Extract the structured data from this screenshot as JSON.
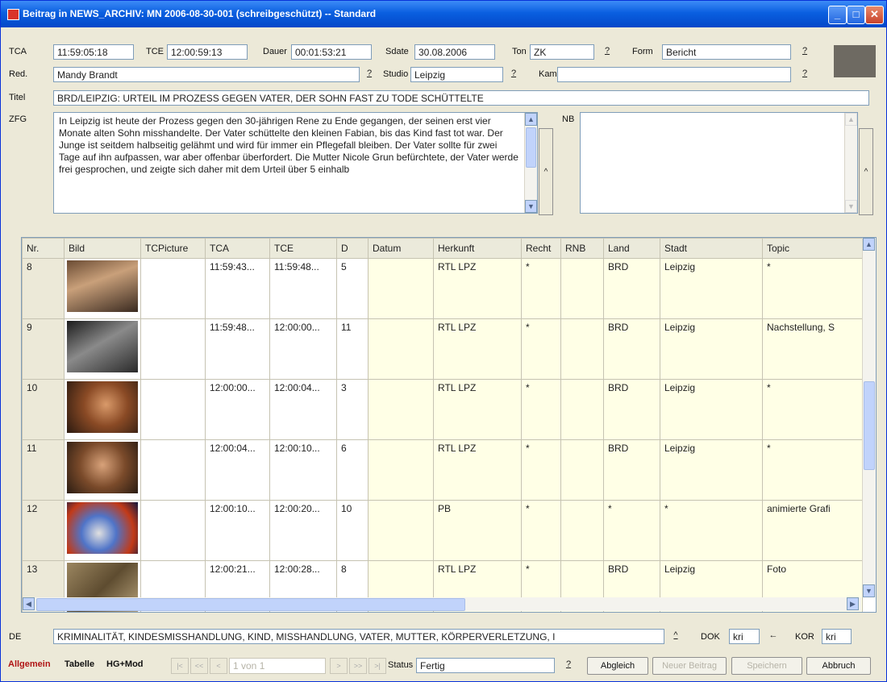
{
  "window": {
    "title": "Beitrag in NEWS_ARCHIV: MN 2006-08-30-001 (schreibgeschützt) -- Standard"
  },
  "fields": {
    "tca_label": "TCA",
    "tca": "11:59:05:18",
    "tce_label": "TCE",
    "tce": "12:00:59:13",
    "dauer_label": "Dauer",
    "dauer": "00:01:53:21",
    "sdate_label": "Sdate",
    "sdate": "30.08.2006",
    "ton_label": "Ton",
    "ton": "ZK",
    "form_label": "Form",
    "form": "Bericht",
    "red_label": "Red.",
    "red": "Mandy Brandt",
    "studio_label": "Studio",
    "studio": "Leipzig",
    "kam_label": "Kam",
    "kam": "",
    "titel_label": "Titel",
    "titel": "BRD/LEIPZIG: URTEIL IM PROZESS GEGEN VATER, DER SOHN FAST ZU TODE SCHÜTTELTE",
    "zfg_label": "ZFG",
    "zfg": "In Leipzig ist heute der Prozess gegen den 30-jährigen Rene zu Ende gegangen, der seinen erst vier Monate alten Sohn misshandelte. Der Vater schüttelte den kleinen Fabian, bis das Kind fast tot war. Der Junge ist seitdem halbseitig gelähmt und wird für immer ein Pflegefall bleiben. Der Vater sollte für zwei Tage auf ihn aufpassen, war aber offenbar überfordert. Die Mutter Nicole Grun befürchtete, der Vater werde frei gesprochen, und zeigte sich daher mit dem Urteil über 5 einhalb",
    "nb_label": "NB",
    "nb": "",
    "help": "?",
    "side_arrow": "^"
  },
  "table": {
    "columns": [
      "Nr.",
      "Bild",
      "TCPicture",
      "TCA",
      "TCE",
      "D",
      "Datum",
      "Herkunft",
      "Recht",
      "RNB",
      "Land",
      "Stadt",
      "Topic"
    ],
    "rows": [
      {
        "nr": "8",
        "tcpicture": "",
        "tca": "11:59:43...",
        "tce": "11:59:48...",
        "d": "5",
        "datum": "",
        "herkunft": "RTL LPZ",
        "recht": "*",
        "rnb": "",
        "land": "BRD",
        "stadt": "Leipzig",
        "topic": "*"
      },
      {
        "nr": "9",
        "tcpicture": "",
        "tca": "11:59:48...",
        "tce": "12:00:00...",
        "d": "11",
        "datum": "",
        "herkunft": "RTL LPZ",
        "recht": "*",
        "rnb": "",
        "land": "BRD",
        "stadt": "Leipzig",
        "topic": "Nachstellung, S"
      },
      {
        "nr": "10",
        "tcpicture": "",
        "tca": "12:00:00...",
        "tce": "12:00:04...",
        "d": "3",
        "datum": "",
        "herkunft": "RTL LPZ",
        "recht": "*",
        "rnb": "",
        "land": "BRD",
        "stadt": "Leipzig",
        "topic": "*"
      },
      {
        "nr": "11",
        "tcpicture": "",
        "tca": "12:00:04...",
        "tce": "12:00:10...",
        "d": "6",
        "datum": "",
        "herkunft": "RTL LPZ",
        "recht": "*",
        "rnb": "",
        "land": "BRD",
        "stadt": "Leipzig",
        "topic": "*"
      },
      {
        "nr": "12",
        "tcpicture": "",
        "tca": "12:00:10...",
        "tce": "12:00:20...",
        "d": "10",
        "datum": "",
        "herkunft": "PB",
        "recht": "*",
        "rnb": "",
        "land": "*",
        "stadt": "*",
        "topic": "animierte Grafi"
      },
      {
        "nr": "13",
        "tcpicture": "",
        "tca": "12:00:21...",
        "tce": "12:00:28...",
        "d": "8",
        "datum": "",
        "herkunft": "RTL LPZ",
        "recht": "*",
        "rnb": "",
        "land": "BRD",
        "stadt": "Leipzig",
        "topic": "Foto"
      }
    ]
  },
  "bottom": {
    "de_label": "DE",
    "de": "KRIMINALITÄT, KINDESMISSHANDLUNG, KIND, MISSHANDLUNG, VATER, MUTTER, KÖRPERVERLETZUNG, I",
    "dok_label": "DOK",
    "dok": "kri",
    "kor_label": "KOR",
    "kor": "kri",
    "tabs": [
      "Allgemein",
      "Tabelle",
      "HG+Mod"
    ],
    "record": "1 von 1",
    "status_label": "Status",
    "status": "Fertig",
    "buttons": {
      "abgleich": "Abgleich",
      "neuer_beitrag": "Neuer Beitrag",
      "speichern": "Speichern",
      "abbruch": "Abbruch"
    },
    "nav": [
      "|<",
      "<<",
      "<",
      ">",
      ">>",
      ">|"
    ]
  },
  "colors": {
    "accent": "#0a5fe0",
    "row_highlight": "#ffffe6",
    "active_tab": "#b01515"
  }
}
